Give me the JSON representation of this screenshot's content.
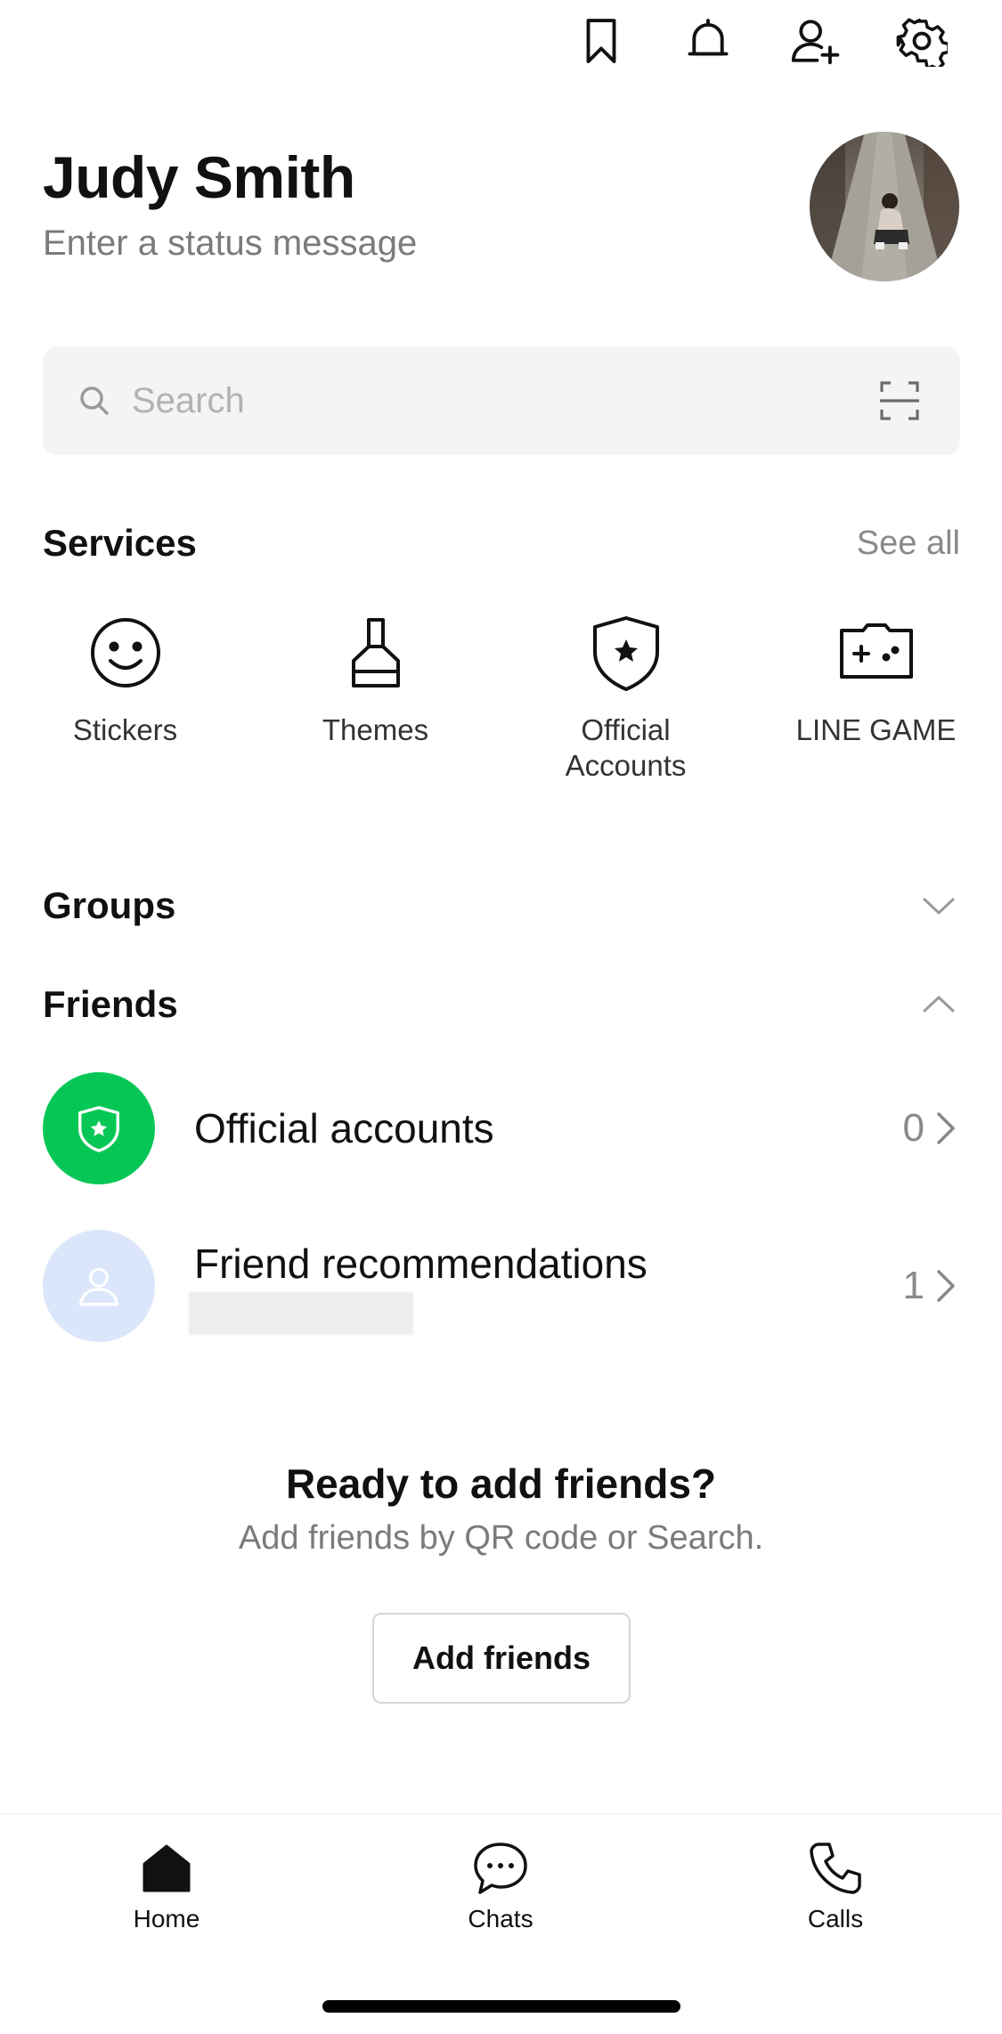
{
  "top_bar": {
    "icons": [
      "bookmark-icon",
      "bell-icon",
      "add-friend-icon",
      "gear-icon"
    ]
  },
  "profile": {
    "name": "Judy Smith",
    "status_placeholder": "Enter a status message"
  },
  "search": {
    "placeholder": "Search"
  },
  "services": {
    "title": "Services",
    "see_all": "See all",
    "items": [
      {
        "label": "Stickers",
        "icon": "smiley-icon"
      },
      {
        "label": "Themes",
        "icon": "paint-brush-icon"
      },
      {
        "label": "Official Accounts",
        "icon": "shield-star-icon"
      },
      {
        "label": "LINE GAME",
        "icon": "game-controller-icon"
      }
    ]
  },
  "groups": {
    "title": "Groups",
    "state": "collapsed"
  },
  "friends": {
    "title": "Friends",
    "state": "expanded",
    "rows": [
      {
        "name": "Official accounts",
        "count": "0",
        "icon": "shield-star-icon",
        "color": "#06c755"
      },
      {
        "name": "Friend recommendations",
        "count": "1",
        "icon": "person-icon",
        "color": "#dbe6fb"
      }
    ]
  },
  "empty_state": {
    "title": "Ready to add friends?",
    "subtitle": "Add friends by QR code or Search.",
    "button": "Add friends"
  },
  "tab_bar": {
    "tabs": [
      {
        "label": "Home",
        "icon": "home-icon",
        "active": true
      },
      {
        "label": "Chats",
        "icon": "chat-bubble-icon",
        "active": false
      },
      {
        "label": "Calls",
        "icon": "phone-icon",
        "active": false
      }
    ]
  },
  "colors": {
    "accent_green": "#06c755",
    "recommendation_bg": "#dbe6fb",
    "search_bg": "#f4f4f4"
  }
}
